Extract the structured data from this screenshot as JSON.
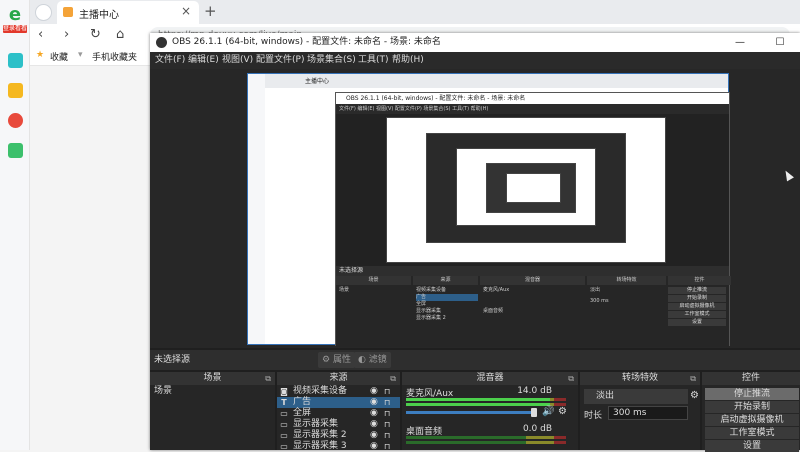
{
  "browser": {
    "sidebar": {
      "badge": "登录看看"
    },
    "tab": {
      "title": "主播中心",
      "close": "×"
    },
    "new_tab": "+",
    "nav": {
      "back": "‹",
      "forward": "›",
      "reload": "↻",
      "home": "⌂"
    },
    "url": "https://mp.douyu.com/live/main",
    "bookmarks": {
      "favorites": "收藏",
      "mobile": "手机收藏夹"
    }
  },
  "obs": {
    "title": "OBS 26.1.1 (64-bit, windows) - 配置文件: 未命名 - 场景: 未命名",
    "window_controls": {
      "minimize": "—",
      "maximize": "☐"
    },
    "menu": [
      "文件(F)",
      "编辑(E)",
      "视图(V)",
      "配置文件(P)",
      "场景集合(S)",
      "工具(T)",
      "帮助(H)"
    ],
    "status": {
      "no_source": "未选择源",
      "properties": "属性",
      "filters": "滤镜"
    },
    "scenes": {
      "header": "场景",
      "items": [
        "场景"
      ]
    },
    "sources": {
      "header": "来源",
      "items": [
        {
          "icon": "camera-icon",
          "name": "视频采集设备"
        },
        {
          "icon": "text-icon",
          "name": "广告"
        },
        {
          "icon": "monitor-icon",
          "name": "全屏"
        },
        {
          "icon": "monitor-icon",
          "name": "显示器采集"
        },
        {
          "icon": "monitor-icon",
          "name": "显示器采集 2"
        },
        {
          "icon": "monitor-icon",
          "name": "显示器采集 3"
        }
      ]
    },
    "mixer": {
      "header": "混音器",
      "channels": [
        {
          "name": "麦克风/Aux",
          "db": "14.0 dB",
          "level": 0.9
        },
        {
          "name": "桌面音频",
          "db": "0.0 dB",
          "level": 0.0
        }
      ]
    },
    "transitions": {
      "header": "转场特效",
      "selected": "淡出",
      "duration_label": "时长",
      "duration_value": "300 ms"
    },
    "controls": {
      "header": "控件",
      "buttons": [
        "停止推流",
        "开始录制",
        "启动虚拟摄像机",
        "工作室模式",
        "设置"
      ]
    },
    "nested": {
      "title": "OBS 26.1.1 (64-bit, windows) - 配置文件: 未命名 - 场景: 未命名",
      "menu": "文件(F)  编辑(E)  视图(V)  配置文件(P)  场景集合(S)  工具(T)  帮助(H)",
      "tab": "主播中心",
      "no_source": "未选择源",
      "docks": [
        "场景",
        "来源",
        "混音器",
        "转场特效",
        "控件"
      ],
      "scene": "场景",
      "sources": [
        "视频采集设备",
        "广告",
        "全屏",
        "显示器采集",
        "显示器采集 2"
      ],
      "mixer": [
        "麦克风/Aux",
        "桌面音频"
      ],
      "transition": "淡出",
      "duration": "300 ms",
      "controls": [
        "停止推流",
        "开始录制",
        "启动虚拟摄像机",
        "工作室模式",
        "设置"
      ]
    }
  },
  "colors": {
    "obs_bg": "#1f1f1f",
    "selected": "#2d5f8a",
    "meter_green": "#4cd04c",
    "fader_blue": "#3d7ec0"
  }
}
